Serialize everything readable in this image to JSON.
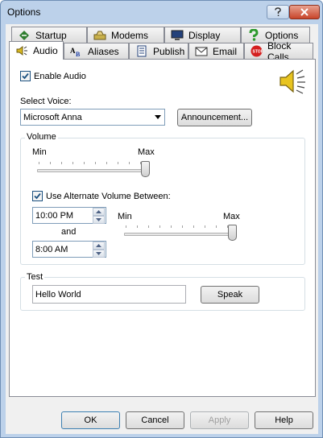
{
  "window": {
    "title": "Options"
  },
  "tabs_row1": [
    {
      "label": "Startup",
      "icon": "startup-icon"
    },
    {
      "label": "Modems",
      "icon": "modems-icon"
    },
    {
      "label": "Display",
      "icon": "display-icon"
    },
    {
      "label": "Options",
      "icon": "options-icon"
    }
  ],
  "tabs_row2": [
    {
      "label": "Audio",
      "icon": "speaker-icon"
    },
    {
      "label": "Aliases",
      "icon": "aliases-icon"
    },
    {
      "label": "Publish",
      "icon": "publish-icon"
    },
    {
      "label": "Email",
      "icon": "email-icon"
    },
    {
      "label": "Block Calls",
      "icon": "stop-icon"
    }
  ],
  "audio": {
    "enable_label": "Enable Audio",
    "enable_checked": true,
    "select_voice_label": "Select Voice:",
    "voice_value": "Microsoft Anna",
    "announcement_button": "Announcement...",
    "volume_group": "Volume",
    "volume_min": "Min",
    "volume_max": "Max",
    "volume_level": 1.0,
    "alt_volume_label": "Use Alternate Volume Between:",
    "alt_volume_checked": true,
    "start_time": "10:00 PM",
    "and_label": "and",
    "end_time": "8:00 AM",
    "alt_min": "Min",
    "alt_max": "Max",
    "alt_volume_level": 1.0,
    "test_group": "Test",
    "test_text": "Hello World",
    "speak_button": "Speak"
  },
  "buttons": {
    "ok": "OK",
    "cancel": "Cancel",
    "apply": "Apply",
    "help": "Help"
  },
  "colors": {
    "title_bg": "#bcd1ea",
    "close_red": "#c8452b",
    "check_blue": "#1c5180"
  }
}
